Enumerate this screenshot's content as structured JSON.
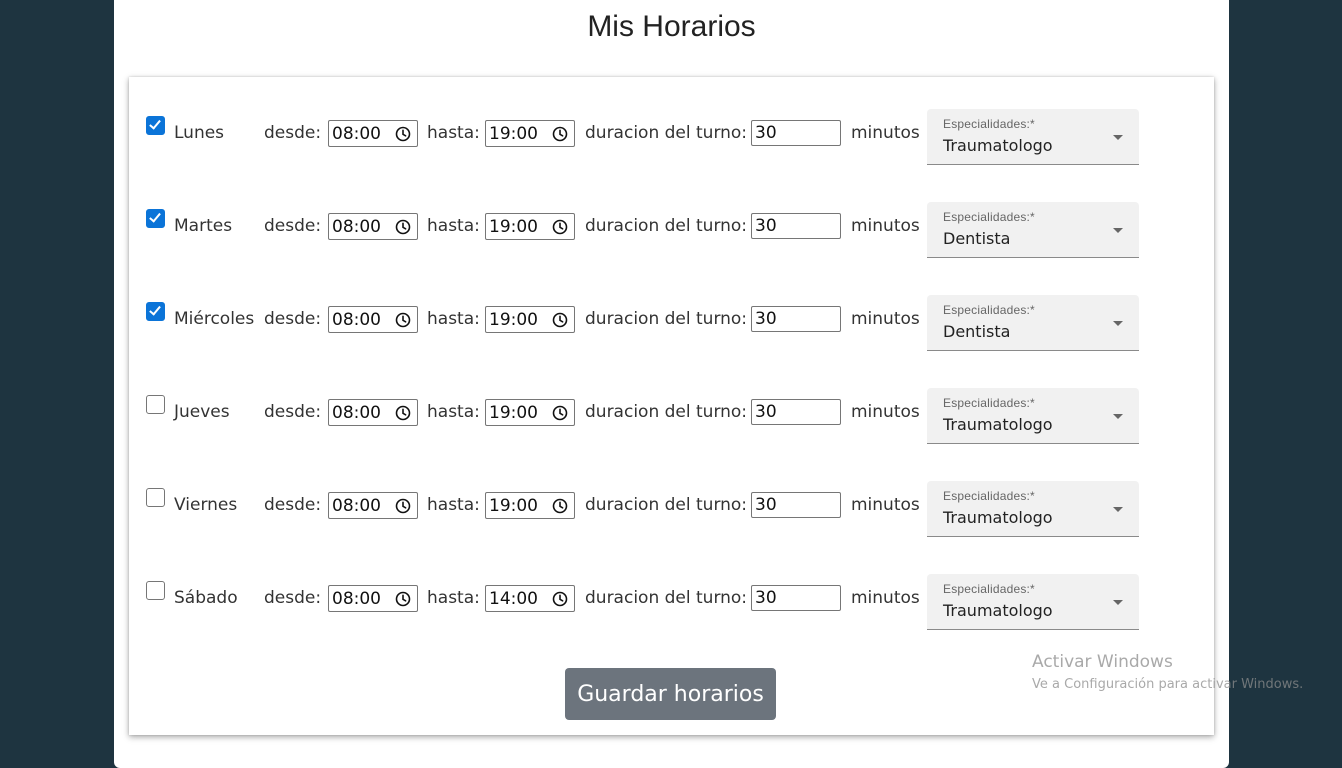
{
  "page": {
    "title": "Mis Horarios",
    "accent_color": "#0b74d8",
    "background_color": "#1e3440"
  },
  "labels": {
    "desde": "desde:",
    "hasta": "hasta:",
    "duracion": "duracion del turno:",
    "minutos": "minutos",
    "especialidades": "Especialidades:*"
  },
  "days": [
    {
      "name": "Lunes",
      "checked": true,
      "desde": "08:00",
      "hasta": "19:00",
      "duracion": "30",
      "especialidad": "Traumatologo"
    },
    {
      "name": "Martes",
      "checked": true,
      "desde": "08:00",
      "hasta": "19:00",
      "duracion": "30",
      "especialidad": "Dentista"
    },
    {
      "name": "Miércoles",
      "checked": true,
      "desde": "08:00",
      "hasta": "19:00",
      "duracion": "30",
      "especialidad": "Dentista"
    },
    {
      "name": "Jueves",
      "checked": false,
      "desde": "08:00",
      "hasta": "19:00",
      "duracion": "30",
      "especialidad": "Traumatologo"
    },
    {
      "name": "Viernes",
      "checked": false,
      "desde": "08:00",
      "hasta": "19:00",
      "duracion": "30",
      "especialidad": "Traumatologo"
    },
    {
      "name": "Sábado",
      "checked": false,
      "desde": "08:00",
      "hasta": "14:00",
      "duracion": "30",
      "especialidad": "Traumatologo"
    }
  ],
  "actions": {
    "save_label": "Guardar horarios"
  },
  "watermark": {
    "title": "Activar Windows",
    "subtitle": "Ve a Configuración para activar Windows."
  }
}
